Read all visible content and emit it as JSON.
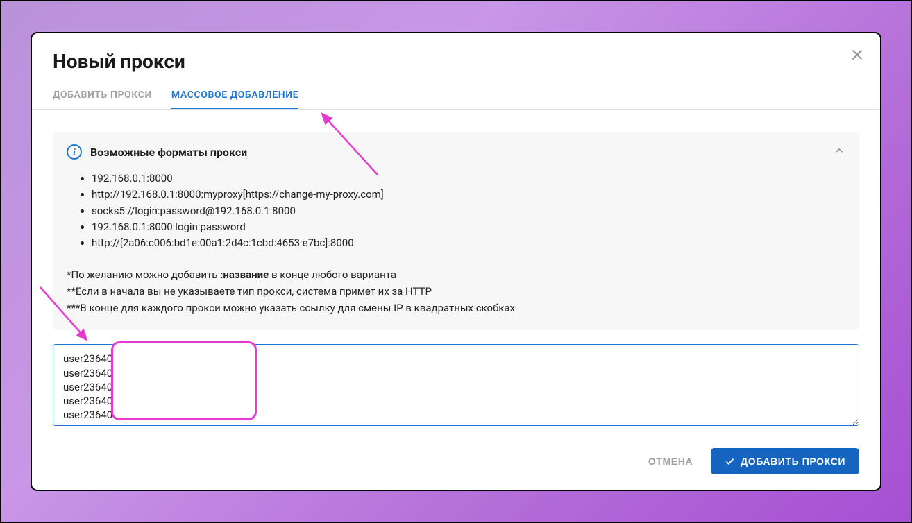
{
  "modal": {
    "title": "Новый прокси",
    "tabs": {
      "add": "ДОБАВИТЬ ПРОКСИ",
      "bulk": "МАССОВОЕ ДОБАВЛЕНИЕ"
    },
    "info": {
      "icon_glyph": "i",
      "title": "Возможные форматы прокси",
      "formats": [
        "192.168.0.1:8000",
        "http://192.168.0.1:8000:myproxy[https://change-my-proxy.com]",
        "socks5://login:password@192.168.0.1:8000",
        "192.168.0.1:8000:login:password",
        "http://[2a06:c006:bd1e:00a1:2d4c:1cbd:4653:e7bc]:8000"
      ],
      "note1_pre": "*По желанию можно добавить ",
      "note1_bold": ":название",
      "note1_post": " в конце любого варианта",
      "note2": "**Если в начала вы не указываете тип прокси, система примет их за HTTP",
      "note3": "***В конце для каждого прокси можно указать ссылку для смены IP в квадратных скобках"
    },
    "textarea": {
      "value": "user236404:\nuser236404:\nuser236404:\nuser236404:\nuser236404:"
    },
    "footer": {
      "cancel": "ОТМЕНА",
      "submit": "ДОБАВИТЬ ПРОКСИ"
    }
  }
}
